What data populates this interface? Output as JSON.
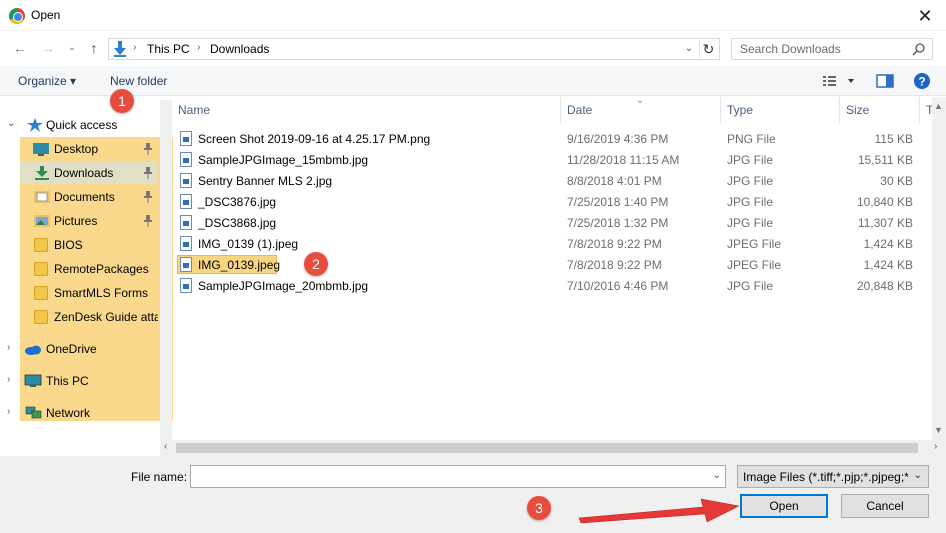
{
  "window": {
    "title": "Open",
    "close": "✕"
  },
  "nav": {
    "back": "←",
    "forward": "→",
    "recent": "⌄",
    "up": "↑",
    "breadcrumbs": [
      "This PC",
      "Downloads"
    ],
    "search_placeholder": "Search Downloads"
  },
  "toolbar": {
    "organize": "Organize ▾",
    "new_folder": "New folder"
  },
  "sidebar": {
    "quick_access": "Quick access",
    "items": [
      {
        "label": "Desktop",
        "icon": "desktop-icon",
        "pinned": true
      },
      {
        "label": "Downloads",
        "icon": "downloads-icon",
        "pinned": true
      },
      {
        "label": "Documents",
        "icon": "documents-icon",
        "pinned": true
      },
      {
        "label": "Pictures",
        "icon": "pictures-icon",
        "pinned": true
      },
      {
        "label": "BIOS",
        "icon": "folder-icon",
        "pinned": false
      },
      {
        "label": "RemotePackages",
        "icon": "folder-icon",
        "pinned": false
      },
      {
        "label": "SmartMLS Forms",
        "icon": "folder-icon",
        "pinned": false
      },
      {
        "label": "ZenDesk Guide atta",
        "icon": "folder-icon",
        "pinned": false
      }
    ],
    "onedrive": "OneDrive",
    "this_pc": "This PC",
    "network": "Network"
  },
  "columns": {
    "name": "Name",
    "date": "Date",
    "type": "Type",
    "size": "Size",
    "tags": "Tag"
  },
  "files": [
    {
      "name": "Screen Shot 2019-09-16 at 4.25.17 PM.png",
      "date": "9/16/2019 4:36 PM",
      "type": "PNG File",
      "size": "115 KB"
    },
    {
      "name": "SampleJPGImage_15mbmb.jpg",
      "date": "11/28/2018 11:15 AM",
      "type": "JPG File",
      "size": "15,511 KB"
    },
    {
      "name": "Sentry Banner MLS 2.jpg",
      "date": "8/8/2018 4:01 PM",
      "type": "JPG File",
      "size": "30 KB"
    },
    {
      "name": "_DSC3876.jpg",
      "date": "7/25/2018 1:40 PM",
      "type": "JPG File",
      "size": "10,840 KB"
    },
    {
      "name": "_DSC3868.jpg",
      "date": "7/25/2018 1:32 PM",
      "type": "JPG File",
      "size": "11,307 KB"
    },
    {
      "name": "IMG_0139 (1).jpeg",
      "date": "7/8/2018 9:22 PM",
      "type": "JPEG File",
      "size": "1,424 KB"
    },
    {
      "name": "IMG_0139.jpeg",
      "date": "7/8/2018 9:22 PM",
      "type": "JPEG File",
      "size": "1,424 KB"
    },
    {
      "name": "SampleJPGImage_20mbmb.jpg",
      "date": "7/10/2016 4:46 PM",
      "type": "JPG File",
      "size": "20,848 KB"
    }
  ],
  "bottom": {
    "file_name_label": "File name:",
    "file_name_value": "",
    "filter": "Image Files (*.tiff;*.pjp;*.pjpeg;*",
    "open": "Open",
    "cancel": "Cancel"
  },
  "annotations": {
    "step1": "1",
    "step2": "2",
    "step3": "3"
  },
  "colors": {
    "highlight": "#f9d57f",
    "badge": "#e84c3d",
    "arrow": "#e53935",
    "accent": "#0078d7"
  }
}
